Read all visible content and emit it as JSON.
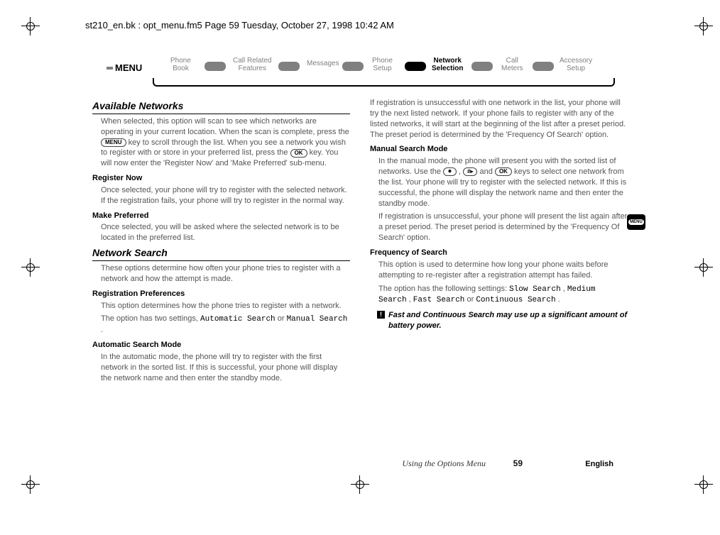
{
  "header": "st210_en.bk : opt_menu.fm5  Page 59  Tuesday, October 27, 1998  10:42 AM",
  "nav": {
    "menu": "MENU",
    "items": [
      {
        "line1": "Phone",
        "line2": "Book"
      },
      {
        "line1": "Call Related",
        "line2": "Features"
      },
      {
        "line1": "Messages",
        "line2": ""
      },
      {
        "line1": "Phone",
        "line2": "Setup"
      },
      {
        "line1": "Network",
        "line2": "Selection"
      },
      {
        "line1": "Call",
        "line2": "Meters"
      },
      {
        "line1": "Accessory",
        "line2": "Setup"
      }
    ]
  },
  "left": {
    "h1a": "Available Networks",
    "p1a": "When selected, this option will scan to see which networks are operating in your current location. When the scan is complete, press the ",
    "p1b": " key to scroll through the list. When you see a network you wish to register with or store in your preferred list, press the ",
    "p1c": " key. You will now enter the 'Register Now' and 'Make Preferred' sub-menu.",
    "h2a": "Register Now",
    "p2": "Once selected, your phone will try to register with the selected network. If the registration fails, your phone will try to register in the normal way.",
    "h2b": "Make Preferred",
    "p3": "Once selected, you will be asked where the selected network is to be located in the preferred list.",
    "h1b": "Network Search",
    "p4": "These options determine how often your phone tries to register with a network and how the attempt is made.",
    "h2c": "Registration Preferences",
    "p5": "This option determines how the phone tries to register with a network.",
    "p6a": "The option has two settings, ",
    "p6b": "Automatic Search",
    "p6c": " or ",
    "p6d": "Manual Search",
    "p6e": ".",
    "h3a": "Automatic Search Mode",
    "p7": "In the automatic mode, the phone will try to register with the first network in the sorted list. If this is successful, your phone will display the network name and then enter the standby mode."
  },
  "right": {
    "p1": "If registration is unsuccessful with one network in the list, your phone will try the next listed network. If your phone fails to register with any of the listed networks, it will start at the beginning of the list after a preset period. The preset period is determined by the 'Frequency Of Search' option.",
    "h3a": "Manual Search Mode",
    "p2a": "In the manual mode, the phone will present you with the sorted list of networks. Use the ",
    "p2b": ", ",
    "p2c": " and ",
    "p2d": " keys to select one network from the list. Your phone will try to register with the selected network. If this is successful, the phone will display the network name and then enter the standby mode.",
    "p3": "If registration is unsuccessful, your phone will present the list again after a preset period. The preset period is determined by the 'Frequency Of Search' option.",
    "h2a": "Frequency of Search",
    "p4": "This option is used to determine how long your phone waits before attempting to re-register after a registration attempt has failed.",
    "p5a": "The option has the following settings: ",
    "p5b": "Slow Search",
    "p5c": ", ",
    "p5d": "Medium Search",
    "p5e": ", ",
    "p5f": "Fast Search",
    "p5g": " or ",
    "p5h": "Continuous Search",
    "p5i": ".",
    "warn": "Fast and Continuous Search may use up a significant amount of battery power."
  },
  "keys": {
    "menu": "MENU",
    "ok": "OK",
    "star": "⁕",
    "hash": "#▸"
  },
  "footer": {
    "title": "Using the Options Menu",
    "page": "59",
    "lang": "English"
  },
  "side_tab": "MENU"
}
